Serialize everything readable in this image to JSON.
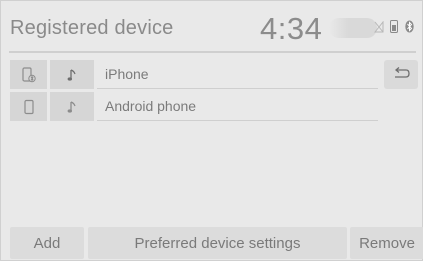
{
  "header": {
    "title": "Registered device",
    "clock": "4:34",
    "status_icons": [
      "no-signal-icon",
      "phone-battery-icon",
      "bluetooth-icon"
    ]
  },
  "devices": [
    {
      "name": "iPhone",
      "device_icon": "phone-bluetooth-icon",
      "audio_icon": "music-note-icon"
    },
    {
      "name": "Android phone",
      "device_icon": "phone-icon",
      "audio_icon": "music-note-icon"
    }
  ],
  "back_button": {
    "icon": "return-arrow-icon"
  },
  "footer": {
    "add": "Add",
    "preferred": "Preferred device settings",
    "remove": "Remove"
  },
  "colors": {
    "background": "#e9e9e9",
    "button": "#dcdcdc",
    "text": "#7b7b7b"
  }
}
